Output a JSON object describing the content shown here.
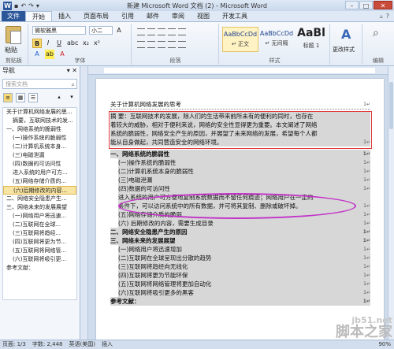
{
  "window": {
    "title": "新建 Microsoft Word 文档 (2) - Microsoft Word",
    "quick_icon": "W"
  },
  "tabs": [
    "文件",
    "开始",
    "插入",
    "页面布局",
    "引用",
    "邮件",
    "审阅",
    "视图",
    "开发工具"
  ],
  "ribbon": {
    "paste_label": "粘贴",
    "clipboard_group": "剪贴板",
    "font_name": "微软雅黑",
    "font_size": "小二",
    "font_group": "字体",
    "para_group": "段落",
    "styles_group": "样式",
    "edit_group": "编辑",
    "styles": [
      {
        "preview": "AaBbCcDd",
        "name": "↵ 正文"
      },
      {
        "preview": "AaBbCcDd",
        "name": "↵ 无间隔"
      },
      {
        "preview": "AaBl",
        "name": "标题 1"
      }
    ],
    "change_styles": "更改样式"
  },
  "nav": {
    "title": "导航",
    "search_placeholder": "搜索文档",
    "items": [
      {
        "text": "关于计算机网络发展的思...",
        "level": 1,
        "selected": false
      },
      {
        "text": "摘要，互联网技术的发...",
        "level": 2,
        "selected": false
      },
      {
        "text": "一、网络系统的脆弱性",
        "level": 1,
        "selected": false
      },
      {
        "text": "(一)操作系统的脆弱性",
        "level": 2,
        "selected": false
      },
      {
        "text": "(二)计算机系统本身...",
        "level": 2,
        "selected": false
      },
      {
        "text": "(三)电磁泄漏",
        "level": 2,
        "selected": false
      },
      {
        "text": "(四)数据的可访问性",
        "level": 2,
        "selected": false
      },
      {
        "text": "进入系统的用户可方...",
        "level": 2,
        "selected": false
      },
      {
        "text": "(五)网络存储介质的...",
        "level": 2,
        "selected": false
      },
      {
        "text": "(六)后期修改的内容...",
        "level": 2,
        "selected": true
      },
      {
        "text": "二、网络安全隐患产生...",
        "level": 1,
        "selected": false
      },
      {
        "text": "三、网络未来的发展展望",
        "level": 1,
        "selected": false
      },
      {
        "text": "(一)网络用户将迅速...",
        "level": 2,
        "selected": false
      },
      {
        "text": "(二)互联网在全球...",
        "level": 2,
        "selected": false
      },
      {
        "text": "(三)互联网将趋经...",
        "level": 2,
        "selected": false
      },
      {
        "text": "(四)互联网将更为节...",
        "level": 2,
        "selected": false
      },
      {
        "text": "(五)互联网将网络管...",
        "level": 2,
        "selected": false
      },
      {
        "text": "(六)互联网将吸引更...",
        "level": 2,
        "selected": false
      },
      {
        "text": "参考文献：",
        "level": 1,
        "selected": false
      }
    ]
  },
  "doc": {
    "lines": [
      {
        "text": "关于计算机网络发展的思考",
        "pm": "1↵",
        "style": "toc"
      },
      {
        "text": "摘 要：互联网技术的发展，除人们的生活带来前所未有的便利的同时，也存在",
        "pm": "",
        "style": "plain"
      },
      {
        "text": "着较大的威胁，相对于便利来说，网络的安全性显得更为重要。本文阐述了网络",
        "pm": "",
        "style": "plain"
      },
      {
        "text": "系统的脆弱性，网络安全产生的原因，并展望了未来网络的发展，希望每个人都",
        "pm": "",
        "style": "plain"
      },
      {
        "text": "能从自身做起，共同营造安全的网络环境。",
        "pm": "1↵",
        "style": "plain"
      },
      {
        "text": "一、网络系统的脆弱性",
        "pm": "1↵",
        "style": "bold"
      },
      {
        "text": "(一)操作系统的脆弱性",
        "pm": "1↵",
        "style": "sub"
      },
      {
        "text": "(二)计算机系统本身的脆弱性",
        "pm": "1↵",
        "style": "sub"
      },
      {
        "text": "(三)电磁泄漏",
        "pm": "1↵",
        "style": "sub"
      },
      {
        "text": "(四)数据的可访问性",
        "pm": "1↵",
        "style": "sub"
      },
      {
        "text": "进入系统的用户可方便地复制系统数据而不留任何痕迹；网络用户在一定的",
        "pm": "",
        "style": "sub"
      },
      {
        "text": "条件下，可以访问系统中的所有数据，并可将其复制、删除或破坏掉。",
        "pm": "1↵",
        "style": "sub"
      },
      {
        "text": "(五)网络存储介质的脆弱",
        "pm": "1↵",
        "style": "sub"
      },
      {
        "text": "(六) 后期修改的内容，需要生成目录",
        "pm": "1↵",
        "style": "sub"
      },
      {
        "text": "二、网络安全隐患产生的原因",
        "pm": "1↵",
        "style": "bold"
      },
      {
        "text": "三、网络未来的发展展望",
        "pm": "1↵",
        "style": "bold"
      },
      {
        "text": "(一)网络用户将迅速增加",
        "pm": "1↵",
        "style": "sub"
      },
      {
        "text": "(二)互联网在全球呈现出分散的趋势",
        "pm": "1↵",
        "style": "sub"
      },
      {
        "text": "(三)互联网将趋经向无线化",
        "pm": "1↵",
        "style": "sub"
      },
      {
        "text": "(四)互联网将更为节能环保",
        "pm": "1↵",
        "style": "sub"
      },
      {
        "text": "(五)互联网将网络管理将更加自动化",
        "pm": "1↵",
        "style": "sub"
      },
      {
        "text": "(六)互联网将吸引更多的黑客",
        "pm": "1↵",
        "style": "sub"
      },
      {
        "text": "参考文献：",
        "pm": "1↵",
        "style": "bold"
      }
    ]
  },
  "status": {
    "page": "页面: 1/3",
    "words": "字数: 2,448",
    "lang": "英语(美国)",
    "mode": "插入",
    "zoom": "90%"
  },
  "watermark": {
    "top": "jb51.net",
    "bottom": "脚本之家"
  }
}
